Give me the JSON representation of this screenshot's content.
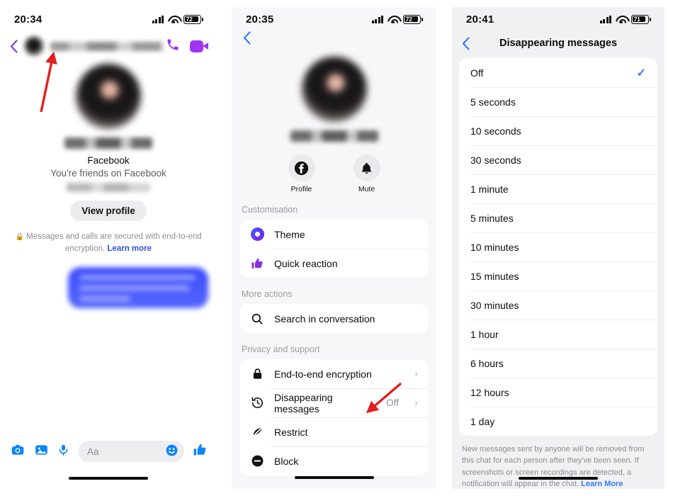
{
  "panels": {
    "chat": {
      "status": {
        "time": "20:34",
        "battery": "72",
        "signal_icon": "cellular-bars-icon",
        "wifi_icon": "wifi-icon"
      },
      "header": {
        "back_icon": "back-chevron-icon",
        "contact_name": "",
        "call_icon": "phone-call-icon",
        "video_icon": "video-call-icon"
      },
      "profile": {
        "platform": "Facebook",
        "relationship": "You're friends on Facebook",
        "view_profile_label": "View profile"
      },
      "encryption_notice": {
        "lock_icon": "lock-icon",
        "text": "Messages and calls are secured with end-to-end encryption. ",
        "link": "Learn more"
      },
      "composer": {
        "camera_icon": "camera-icon",
        "gallery_icon": "photo-gallery-icon",
        "mic_icon": "microphone-icon",
        "input_placeholder": "Aa",
        "input_value": "",
        "emoji_icon": "smiley-icon",
        "thumbs_icon": "thumbs-up-icon"
      }
    },
    "details": {
      "status": {
        "time": "20:35",
        "battery": "72"
      },
      "header": {
        "back_icon": "back-chevron-icon"
      },
      "quick_actions": [
        {
          "label": "Profile",
          "icon": "facebook-icon"
        },
        {
          "label": "Mute",
          "icon": "bell-icon"
        }
      ],
      "sections": [
        {
          "title": "Customisation",
          "rows": [
            {
              "label": "Theme",
              "icon": "theme-circle-icon",
              "value": "",
              "chevron": false
            },
            {
              "label": "Quick reaction",
              "icon": "thumbs-up-icon",
              "value": "",
              "chevron": false
            }
          ]
        },
        {
          "title": "More actions",
          "rows": [
            {
              "label": "Search in conversation",
              "icon": "search-icon",
              "value": "",
              "chevron": false
            }
          ]
        },
        {
          "title": "Privacy and support",
          "rows": [
            {
              "label": "End-to-end encryption",
              "icon": "lock-icon",
              "value": "",
              "chevron": true
            },
            {
              "label": "Disappearing messages",
              "icon": "clock-history-icon",
              "value": "Off",
              "chevron": true
            },
            {
              "label": "Restrict",
              "icon": "restrict-icon",
              "value": "",
              "chevron": false
            },
            {
              "label": "Block",
              "icon": "block-icon",
              "value": "",
              "chevron": false
            }
          ]
        }
      ]
    },
    "disappearing": {
      "status": {
        "time": "20:41",
        "battery": "71"
      },
      "nav": {
        "back_icon": "back-chevron-icon",
        "title": "Disappearing messages"
      },
      "options": [
        {
          "label": "Off",
          "selected": true
        },
        {
          "label": "5 seconds",
          "selected": false
        },
        {
          "label": "10 seconds",
          "selected": false
        },
        {
          "label": "30 seconds",
          "selected": false
        },
        {
          "label": "1 minute",
          "selected": false
        },
        {
          "label": "5 minutes",
          "selected": false
        },
        {
          "label": "10 minutes",
          "selected": false
        },
        {
          "label": "15 minutes",
          "selected": false
        },
        {
          "label": "30 minutes",
          "selected": false
        },
        {
          "label": "1 hour",
          "selected": false
        },
        {
          "label": "6 hours",
          "selected": false
        },
        {
          "label": "12 hours",
          "selected": false
        },
        {
          "label": "1 day",
          "selected": false
        }
      ],
      "footnote": {
        "text": "New messages sent by anyone will be removed from this chat for each person after they've been seen. If screenshots or screen recordings are detected, a notification will appear in the chat. ",
        "link": "Learn More"
      }
    }
  },
  "annotations": [
    {
      "name": "arrow-to-contact-avatar",
      "color": "#e02020"
    },
    {
      "name": "arrow-to-disappearing-messages",
      "color": "#e02020"
    }
  ],
  "colors": {
    "accent_blue": "#0a84ff",
    "link_blue": "#2f7bf5",
    "purple": "#a033f5",
    "bubble_blue": "#4a5afd",
    "annotation_red": "#e02020"
  }
}
